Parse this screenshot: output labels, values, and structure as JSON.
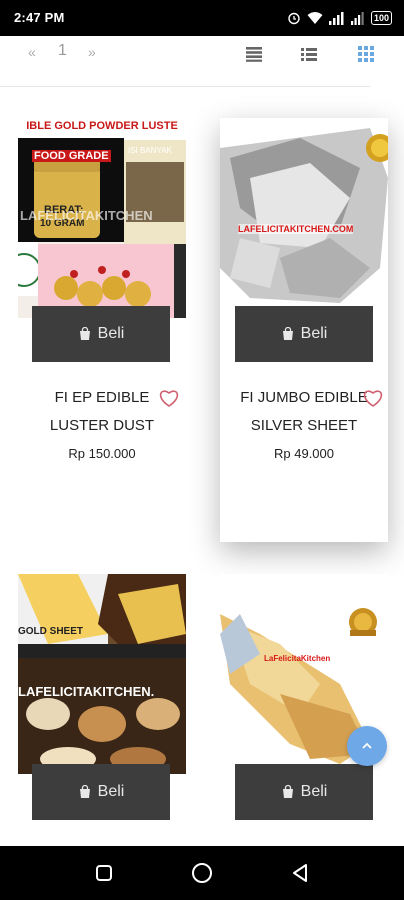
{
  "status_bar": {
    "time": "2:47 PM",
    "battery": "100"
  },
  "pager": {
    "prev": "«",
    "current_page": "1",
    "next": "»"
  },
  "products": [
    {
      "image_text": [
        "IBLE GOLD POWDER LUSTE",
        "FOOD GRADE",
        "BERAT:",
        "10 GRAM",
        "ISI BANYAK",
        "LAFELICITAKITCHEN"
      ],
      "button_label": "Beli",
      "name_line1": "FI EP EDIBLE",
      "name_line2": "LUSTER DUST",
      "price": "Rp 150.000"
    },
    {
      "image_text": [
        "LAFELICITAKITCHEN.COM"
      ],
      "button_label": "Beli",
      "name_line1": "FI JUMBO EDIBLE",
      "name_line2": "SILVER SHEET",
      "price": "Rp 49.000"
    },
    {
      "image_text": [
        "GOLD SHEET",
        "LAFELICITAKITCHEN."
      ],
      "button_label": "Beli"
    },
    {
      "image_text": [
        "LaFelicitaKitchen"
      ],
      "button_label": "Beli"
    }
  ],
  "colors": {
    "button_bg": "#3d3d3d",
    "heart": "#d06070",
    "fab": "#6fa8e6"
  },
  "icons": {
    "bag": "shopping-bag-icon",
    "heart": "heart-outline-icon",
    "up": "chevron-up-icon"
  }
}
